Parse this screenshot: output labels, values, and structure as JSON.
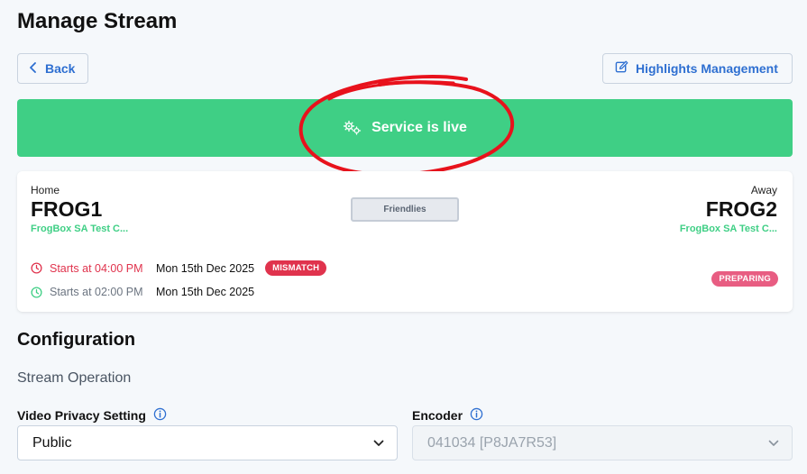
{
  "page": {
    "title": "Manage Stream"
  },
  "toolbar": {
    "back_label": "Back",
    "highlights_label": "Highlights Management"
  },
  "banner": {
    "text": "Service is live",
    "color": "#3fcf85"
  },
  "match": {
    "home": {
      "side_label": "Home",
      "name": "FROG1",
      "club": "FrogBox SA Test C..."
    },
    "away": {
      "side_label": "Away",
      "name": "FROG2",
      "club": "FrogBox SA Test C..."
    },
    "competition": "Friendlies",
    "scheduled": {
      "starts": "Starts at 04:00 PM",
      "date": "Mon 15th Dec 2025",
      "badge": "MISMATCH",
      "color": "#e0334d"
    },
    "actual": {
      "starts": "Starts at 02:00 PM",
      "date": "Mon 15th Dec 2025",
      "color": "#3fcf85"
    },
    "status_badge": "PREPARING"
  },
  "configuration": {
    "title": "Configuration",
    "subtitle": "Stream Operation",
    "privacy": {
      "label": "Video Privacy Setting",
      "value": "Public"
    },
    "encoder": {
      "label": "Encoder",
      "value": "041034 [P8JA7R53]"
    }
  }
}
